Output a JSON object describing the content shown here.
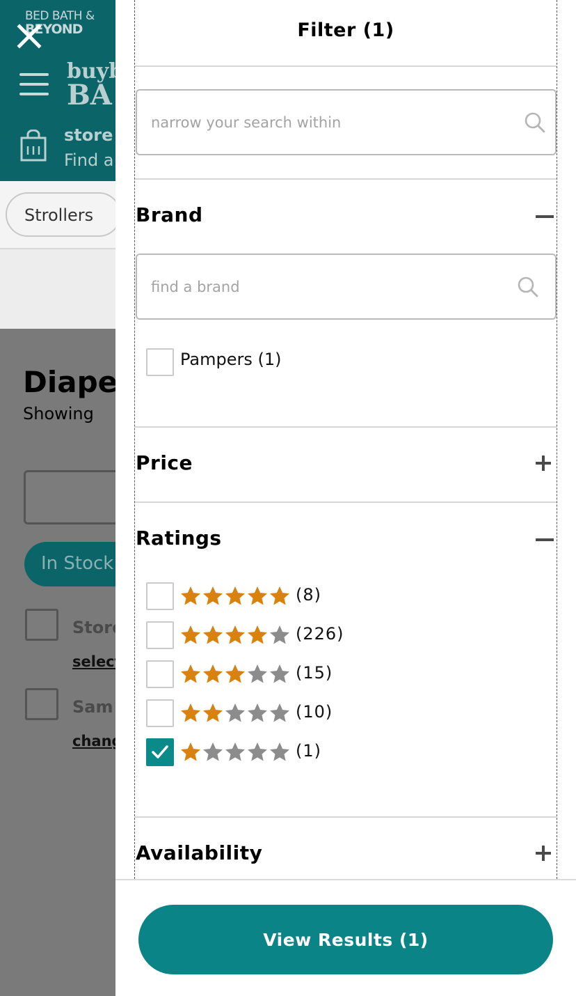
{
  "background_page": {
    "logo_line1": "BED BATH &",
    "logo_line2": "BEYOND",
    "brand_line1": "buyb",
    "brand_line2": "BA",
    "store_title": "store",
    "store_subtitle": "Find a",
    "chip_label": "Strollers",
    "page_title": "Diape",
    "showing_text": "Showing",
    "in_stock_label": "In Stock",
    "option1_label": "Store",
    "option1_link": "select",
    "option2_label": "Sam",
    "option2_link": "chang"
  },
  "filter": {
    "title": "Filter (1)",
    "search_placeholder": "narrow your search within",
    "sections": {
      "brand": {
        "label": "Brand",
        "expanded": true,
        "search_placeholder": "find a brand",
        "options": [
          {
            "label": "Pampers (1)",
            "checked": false
          }
        ]
      },
      "price": {
        "label": "Price",
        "expanded": false
      },
      "ratings": {
        "label": "Ratings",
        "expanded": true,
        "options": [
          {
            "stars": 5,
            "count": "(8)",
            "checked": false
          },
          {
            "stars": 4,
            "count": "(226)",
            "checked": false
          },
          {
            "stars": 3,
            "count": "(15)",
            "checked": false
          },
          {
            "stars": 2,
            "count": "(10)",
            "checked": false
          },
          {
            "stars": 1,
            "count": "(1)",
            "checked": true
          }
        ]
      },
      "availability": {
        "label": "Availability",
        "expanded": false
      }
    },
    "view_results_label": "View Results (1)"
  },
  "colors": {
    "accent_teal": "#0b8487",
    "star_filled": "#d9820a",
    "star_empty": "#8c8c8c",
    "header_teal": "#0a6468"
  },
  "icons": {
    "close": "close-icon",
    "search": "search-icon",
    "collapse": "minus-icon",
    "expand": "plus-icon",
    "check": "checkmark-icon",
    "star": "star-icon"
  }
}
